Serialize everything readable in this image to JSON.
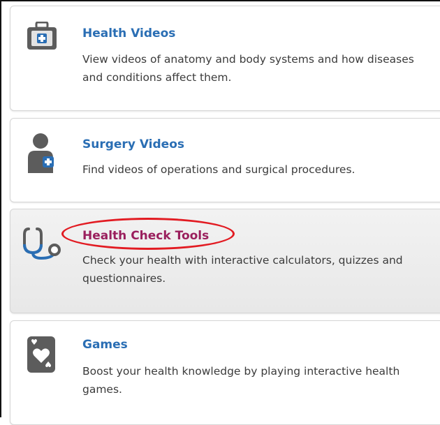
{
  "cards": [
    {
      "title": "Health Videos",
      "description": "View videos of anatomy and body systems and how diseases and conditions affect them.",
      "icon": "medical-kit-icon"
    },
    {
      "title": "Surgery Videos",
      "description": "Find videos of operations and surgical procedures.",
      "icon": "surgeon-icon"
    },
    {
      "title": "Health Check Tools",
      "description": "Check your health with interactive calculators, quizzes and questionnaires.",
      "icon": "stethoscope-icon"
    },
    {
      "title": "Games",
      "description": "Boost your health knowledge by playing interactive health games.",
      "icon": "heart-card-icon"
    }
  ],
  "colors": {
    "link_blue": "#2a6eb4",
    "active_title": "#9a1f5d",
    "icon_gray": "#5c5c5c",
    "icon_accent": "#2a6eb4",
    "highlight_red": "#e21b22"
  }
}
